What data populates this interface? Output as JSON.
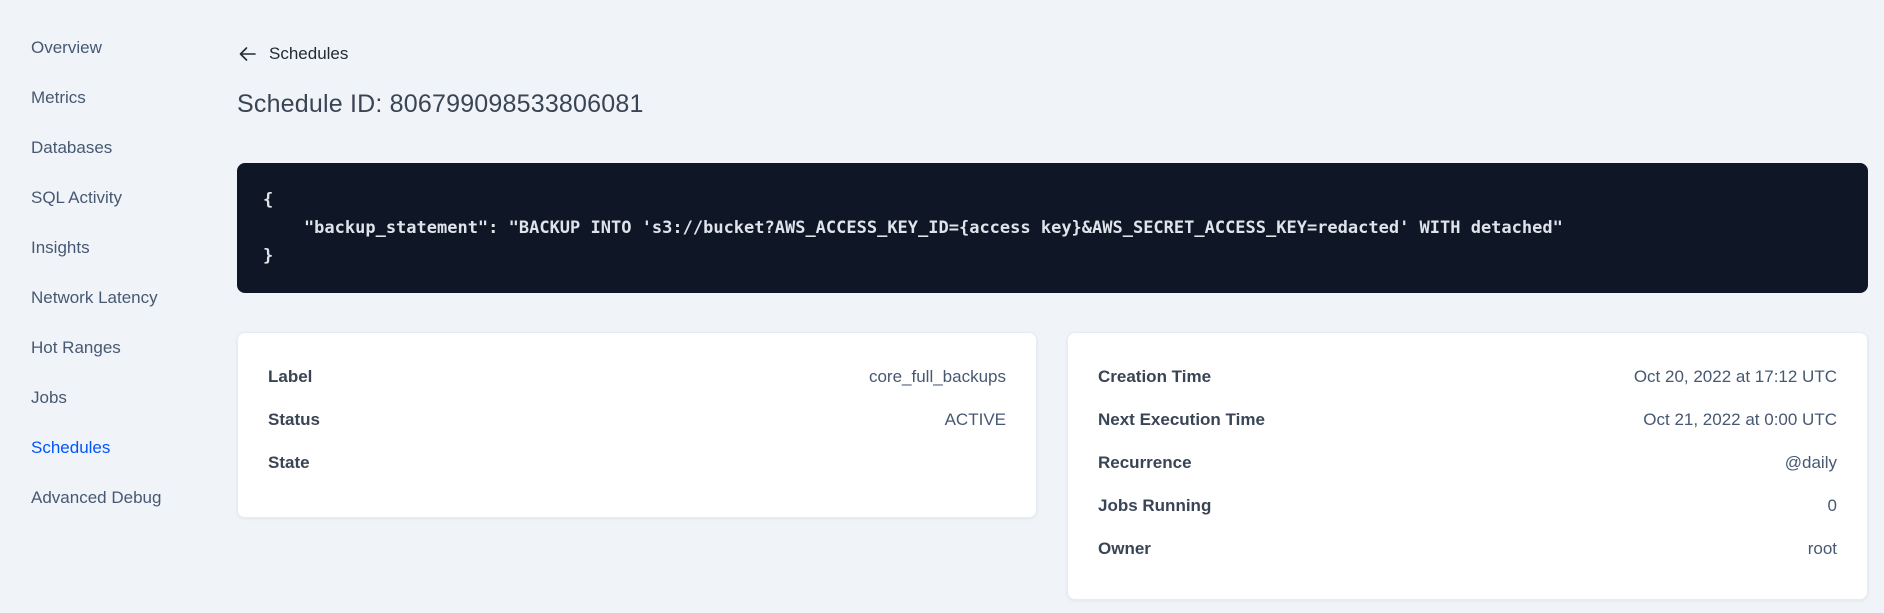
{
  "sidebar": {
    "items": [
      {
        "label": "Overview",
        "active": false
      },
      {
        "label": "Metrics",
        "active": false
      },
      {
        "label": "Databases",
        "active": false
      },
      {
        "label": "SQL Activity",
        "active": false
      },
      {
        "label": "Insights",
        "active": false
      },
      {
        "label": "Network Latency",
        "active": false
      },
      {
        "label": "Hot Ranges",
        "active": false
      },
      {
        "label": "Jobs",
        "active": false
      },
      {
        "label": "Schedules",
        "active": true
      },
      {
        "label": "Advanced Debug",
        "active": false
      }
    ]
  },
  "page": {
    "back_label": "Schedules",
    "title": "Schedule ID: 806799098533806081"
  },
  "code": {
    "lines": [
      "{",
      "    \"backup_statement\": \"BACKUP INTO 's3://bucket?AWS_ACCESS_KEY_ID={access key}&AWS_SECRET_ACCESS_KEY=redacted' WITH detached\"",
      "}"
    ]
  },
  "cards": {
    "schedule": {
      "rows": [
        {
          "label": "Label",
          "value": "core_full_backups"
        },
        {
          "label": "Status",
          "value": "ACTIVE"
        },
        {
          "label": "State",
          "value": ""
        }
      ]
    },
    "execution": {
      "rows": [
        {
          "label": "Creation Time",
          "value": "Oct 20, 2022 at 17:12 UTC"
        },
        {
          "label": "Next Execution Time",
          "value": "Oct 21, 2022 at 0:00 UTC"
        },
        {
          "label": "Recurrence",
          "value": "@daily"
        },
        {
          "label": "Jobs Running",
          "value": "0"
        },
        {
          "label": "Owner",
          "value": "root"
        }
      ]
    }
  },
  "colors": {
    "accent": "#0055ff",
    "code_background": "#0f1726",
    "page_background": "#f0f4f8"
  }
}
